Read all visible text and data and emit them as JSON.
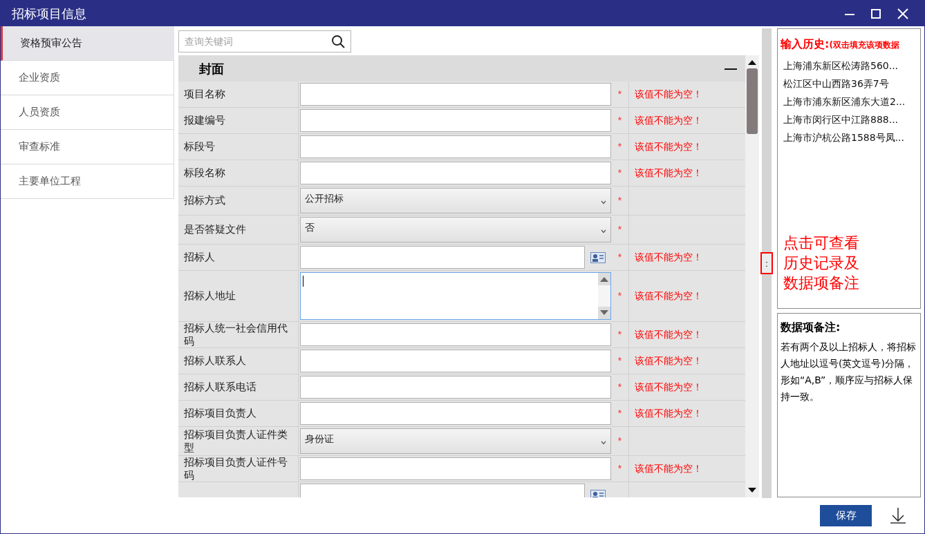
{
  "window": {
    "title": "招标项目信息"
  },
  "sidebar": {
    "items": [
      {
        "label": "资格预审公告",
        "selected": true
      },
      {
        "label": "企业资质",
        "selected": false
      },
      {
        "label": "人员资质",
        "selected": false
      },
      {
        "label": "审查标准",
        "selected": false
      },
      {
        "label": "主要单位工程",
        "selected": false
      }
    ]
  },
  "search": {
    "placeholder": "查询关键词"
  },
  "section": {
    "title": "封面",
    "collapse": "—"
  },
  "fields": [
    {
      "label": "项目名称",
      "kind": "text",
      "required_mark": "*",
      "error": "该值不能为空！"
    },
    {
      "label": "报建编号",
      "kind": "text",
      "required_mark": "*",
      "error": "该值不能为空！"
    },
    {
      "label": "标段号",
      "kind": "text",
      "required_mark": "*",
      "error": "该值不能为空！"
    },
    {
      "label": "标段名称",
      "kind": "text",
      "required_mark": "*",
      "error": "该值不能为空！"
    },
    {
      "label": "招标方式",
      "kind": "select",
      "value": "公开招标",
      "required_mark": "*"
    },
    {
      "label": "是否答疑文件",
      "kind": "select",
      "value": "否",
      "required_mark": "*"
    },
    {
      "label": "招标人",
      "kind": "picker",
      "required_mark": "*",
      "error": "该值不能为空！"
    },
    {
      "label": "招标人地址",
      "kind": "textarea",
      "focused": true,
      "required_mark": "*",
      "error": "该值不能为空！"
    },
    {
      "label": "招标人统一社会信用代码",
      "kind": "text",
      "required_mark": "*",
      "error": "该值不能为空！"
    },
    {
      "label": "招标人联系人",
      "kind": "text",
      "required_mark": "*",
      "error": "该值不能为空！"
    },
    {
      "label": "招标人联系电话",
      "kind": "text",
      "required_mark": "*",
      "error": "该值不能为空！"
    },
    {
      "label": "招标项目负责人",
      "kind": "text",
      "required_mark": "*",
      "error": "该值不能为空！"
    },
    {
      "label": "招标项目负责人证件类型",
      "kind": "select",
      "value": "身份证",
      "required_mark": "*"
    },
    {
      "label": "招标项目负责人证件号码",
      "kind": "text",
      "required_mark": "*",
      "error": "该值不能为空！"
    },
    {
      "kind": "picker"
    }
  ],
  "history": {
    "title": "输入历史:",
    "hint": "(双击填充该项数据",
    "entries": [
      "上海浦东新区松涛路560...",
      "松江区中山西路36弄7号",
      "上海市浦东新区浦东大道2...",
      "上海市闵行区中江路888...",
      "上海市沪杭公路1588号凤..."
    ]
  },
  "splitter": {
    "handle": ":",
    "callout": "点击可查看历史记录及数据项备注"
  },
  "notes": {
    "title": "数据项备注:",
    "body": "若有两个及以上招标人，将招标人地址以逗号(英文逗号)分隔，形如“A,B”，顺序应与招标人保持一致。"
  },
  "buttons": {
    "save": "保存"
  }
}
